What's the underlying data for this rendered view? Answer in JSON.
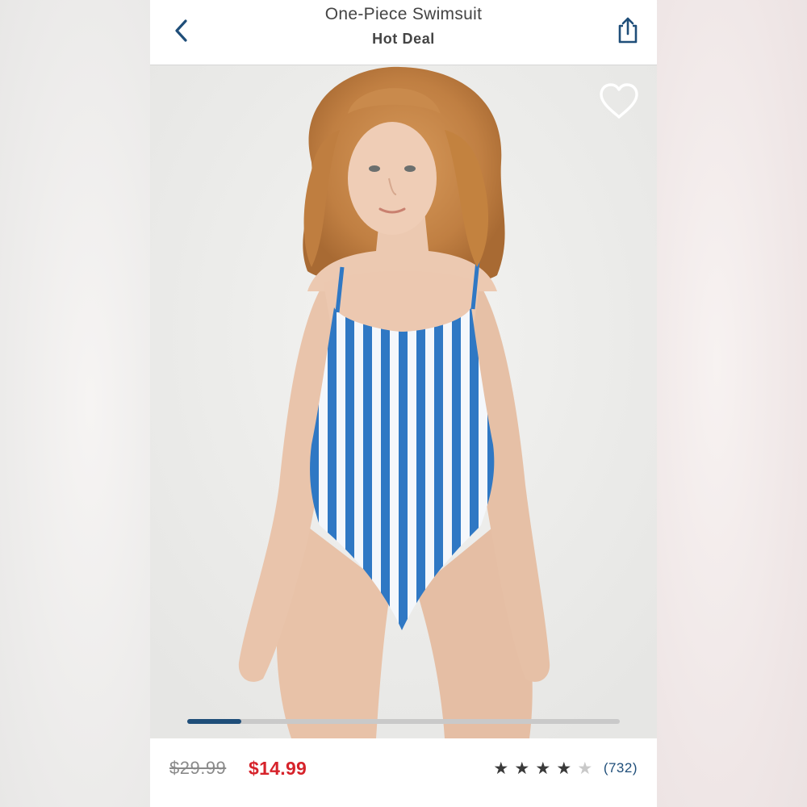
{
  "header": {
    "title": "One-Piece Swimsuit",
    "subtitle": "Hot Deal",
    "back_icon": "chevron-left-icon",
    "share_icon": "share-icon"
  },
  "product_image": {
    "favorite_icon": "heart-outline-icon",
    "carousel_progress": 0.125,
    "colors": {
      "stripe_blue": "#2f78c4",
      "stripe_white": "#f4f7fb",
      "background": "#eeeeec",
      "hair": "#c8874a",
      "skin": "#e9c4ab"
    }
  },
  "price": {
    "original": "$29.99",
    "sale": "$14.99"
  },
  "rating": {
    "stars": 4,
    "max": 5,
    "review_count": "(732)"
  },
  "colors": {
    "accent_navy": "#1f4e79",
    "sale_red": "#d6232b"
  }
}
